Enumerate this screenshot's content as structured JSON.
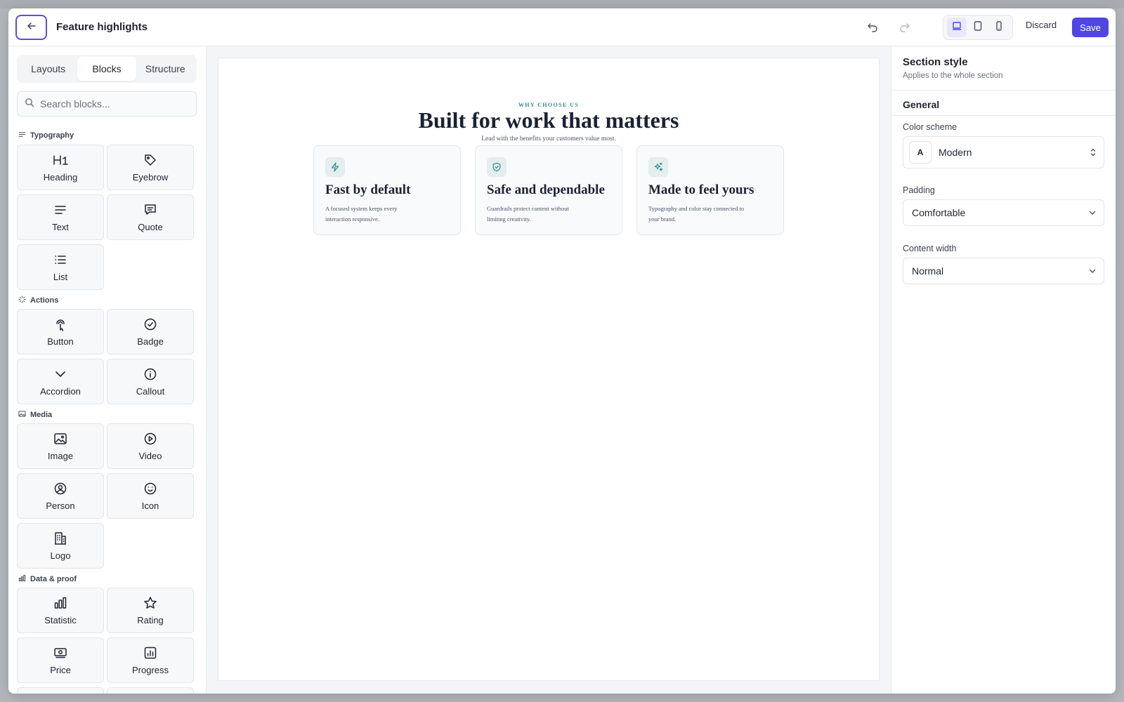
{
  "topbar": {
    "title": "Feature highlights",
    "discard_label": "Discard",
    "save_label": "Save"
  },
  "sidebar": {
    "tabs": [
      {
        "label": "Layouts",
        "active": false
      },
      {
        "label": "Blocks",
        "active": true
      },
      {
        "label": "Structure",
        "active": false
      }
    ],
    "search_placeholder": "Search blocks...",
    "categories": [
      {
        "label": "Typography",
        "icon": "text-lines-icon"
      },
      {
        "label": "Actions",
        "icon": "sparkle-icon"
      },
      {
        "label": "Media",
        "icon": "image-icon"
      },
      {
        "label": "Data & proof",
        "icon": "bar-chart-icon"
      }
    ],
    "blocks": {
      "heading": "Heading",
      "eyebrow": "Eyebrow",
      "text": "Text",
      "quote": "Quote",
      "list": "List",
      "button": "Button",
      "badge": "Badge",
      "accordion": "Accordion",
      "callout": "Callout",
      "image": "Image",
      "video": "Video",
      "person": "Person",
      "icon": "Icon",
      "logo": "Logo",
      "statistic": "Statistic",
      "rating": "Rating",
      "price": "Price",
      "progress": "Progress"
    }
  },
  "canvas": {
    "eyebrow": "WHY CHOOSE US",
    "headline": "Built for work that matters",
    "subhead": "Lead with the benefits your customers value most.",
    "cards": [
      {
        "title": "Fast by default",
        "desc": "A focused system keeps every interaction responsive.",
        "icon": "lightning-icon"
      },
      {
        "title": "Safe and dependable",
        "desc": "Guardrails protect content without limiting creativity.",
        "icon": "shield-check-icon"
      },
      {
        "title": "Made to feel yours",
        "desc": "Typography and color stay connected to your brand.",
        "icon": "sparkles-icon"
      }
    ]
  },
  "panel": {
    "title": "Section style",
    "subtitle": "Applies to the whole section",
    "section": "General",
    "color_scheme_label": "Color scheme",
    "color_scheme_badge": "A",
    "color_scheme_value": "Modern",
    "padding_label": "Padding",
    "padding_value": "Comfortable",
    "width_label": "Content width",
    "width_value": "Normal"
  },
  "colors": {
    "accent": "#5046e5",
    "teal": "#2f8f84",
    "heading": "#1a2233"
  }
}
